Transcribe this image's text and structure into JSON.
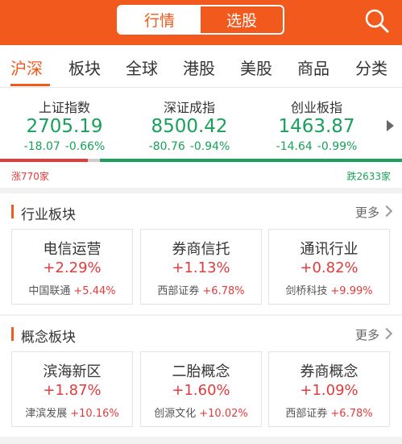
{
  "header": {
    "seg_active": "行情",
    "seg_inactive": "选股"
  },
  "tabs": [
    "沪深",
    "板块",
    "全球",
    "港股",
    "美股",
    "商品",
    "分类"
  ],
  "indices": [
    {
      "name": "上证指数",
      "value": "2705.19",
      "change": "-18.07",
      "pct": "-0.66%"
    },
    {
      "name": "深证成指",
      "value": "8500.42",
      "change": "-80.76",
      "pct": "-0.94%"
    },
    {
      "name": "创业板指",
      "value": "1463.87",
      "change": "-14.64",
      "pct": "-0.99%"
    }
  ],
  "breadth": {
    "up_label": "涨770家",
    "down_label": "跌2633家",
    "up_fraction": 0.226
  },
  "industry": {
    "title": "行业板块",
    "more": "更多",
    "cards": [
      {
        "name": "电信运营",
        "pct": "+2.29%",
        "leader": "中国联通",
        "leader_pct": "+5.44%"
      },
      {
        "name": "券商信托",
        "pct": "+1.13%",
        "leader": "西部证券",
        "leader_pct": "+6.78%"
      },
      {
        "name": "通讯行业",
        "pct": "+0.82%",
        "leader": "剑桥科技",
        "leader_pct": "+9.99%"
      }
    ]
  },
  "concept": {
    "title": "概念板块",
    "more": "更多",
    "cards": [
      {
        "name": "滨海新区",
        "pct": "+1.87%",
        "leader": "津滨发展",
        "leader_pct": "+10.16%"
      },
      {
        "name": "二胎概念",
        "pct": "+1.60%",
        "leader": "创源文化",
        "leader_pct": "+10.02%"
      },
      {
        "name": "券商概念",
        "pct": "+1.09%",
        "leader": "西部证券",
        "leader_pct": "+6.78%"
      }
    ]
  },
  "colors": {
    "brand": "#f2591c",
    "up": "#e33b3b",
    "down": "#19a15b"
  }
}
